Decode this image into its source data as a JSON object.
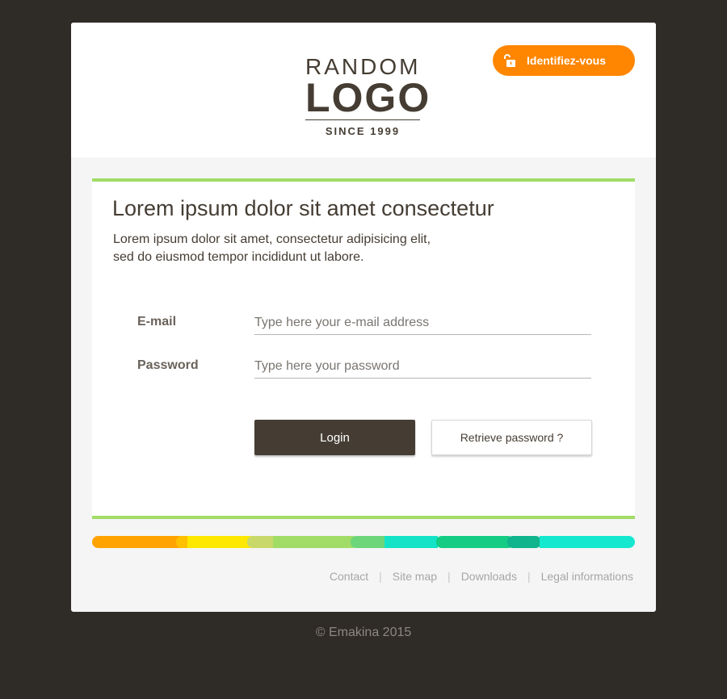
{
  "header": {
    "logo": {
      "top": "RANDOM",
      "main": "LOGO",
      "sub": "SINCE 1999"
    },
    "identify_button": {
      "label": "Identifiez-vous",
      "icon": "unlock-icon"
    }
  },
  "panel": {
    "title": "Lorem ipsum dolor sit amet consectetur",
    "intro_line1": "Lorem ipsum dolor sit amet, consectetur adipisicing elit,",
    "intro_line2": "sed do eiusmod tempor incididunt ut labore."
  },
  "form": {
    "email": {
      "label": "E-mail",
      "value": "",
      "placeholder": "Type here your e-mail address"
    },
    "password": {
      "label": "Password",
      "value": "",
      "placeholder": "Type here your password"
    },
    "login_label": "Login",
    "retrieve_label": "Retrieve password ?"
  },
  "footer": {
    "links": [
      "Contact",
      "Site map",
      "Downloads",
      "Legal informations"
    ],
    "separator": "|",
    "copyright": "© Emakina 2015"
  },
  "colors": {
    "page_background": "#2f2b27",
    "accent_orange": "#ff8600",
    "accent_green": "#a1dd66",
    "brand_dark": "#453d33",
    "strip": [
      "#ffa300",
      "#ffc000",
      "#ffe800",
      "#c8d96a",
      "#a1dd66",
      "#6ed67a",
      "#14e3c8",
      "#14cc84",
      "#10b48c",
      "#14e8cf"
    ]
  }
}
